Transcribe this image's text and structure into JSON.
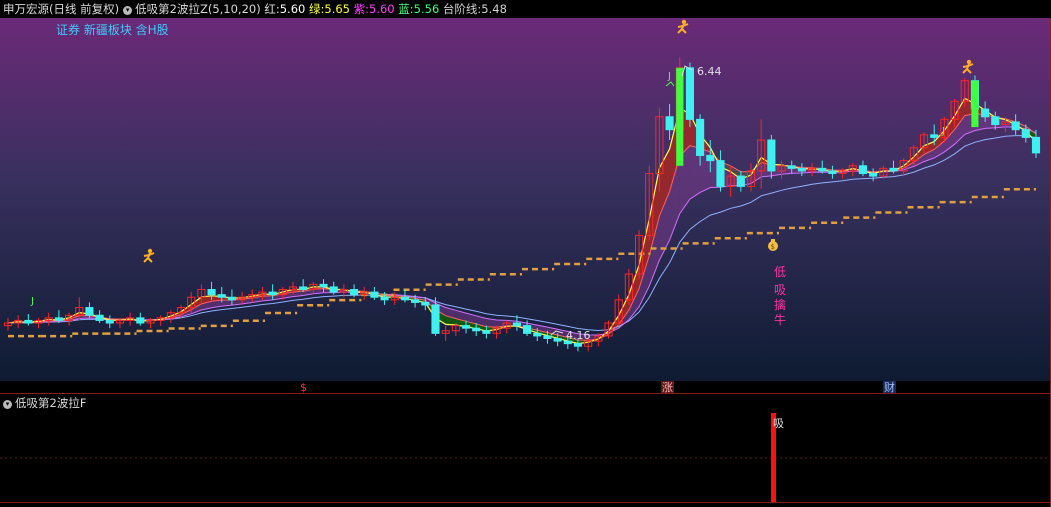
{
  "header": {
    "stock": "申万宏源",
    "mode": "(日线 前复权)",
    "indicator": "低吸第2波拉Z(5,10,20)",
    "items": [
      {
        "label": "红:",
        "value": "5.60",
        "color": "#ff4040"
      },
      {
        "label": "绿:",
        "value": "5.65",
        "color": "#ffff40"
      },
      {
        "label": "紫:",
        "value": "5.60",
        "color": "#ff40ff"
      },
      {
        "label": "蓝:",
        "value": "5.56",
        "color": "#40ff40"
      },
      {
        "label": "台阶线:",
        "value": "5.48",
        "color": "#d0d0d0"
      }
    ]
  },
  "tags": "证券 新疆板块 含H股",
  "markers": {
    "high_label": "6.44",
    "low_label": "4.16",
    "signal_text": [
      "低",
      "吸",
      "擒",
      "牛"
    ],
    "J": "J",
    "axis_marks": [
      "$",
      "涨",
      "财"
    ]
  },
  "subpanel": {
    "title": "低吸第2波拉F",
    "bar_label": "吸"
  },
  "colors": {
    "bg_top": "#6b2a78",
    "bg_mid": "#38305e",
    "bg_bottom": "#0e1b32",
    "up": "#ff2424",
    "down": "#3ff0f0",
    "step_line": "#e0a040",
    "ribbon_red": "#a02828",
    "ribbon_green": "#0e5f0e",
    "ribbon_purple": "#7a3a8c"
  },
  "chart_data": {
    "type": "candlestick",
    "candles": [
      [
        4.36,
        4.42,
        4.32,
        4.38
      ],
      [
        4.38,
        4.44,
        4.34,
        4.4
      ],
      [
        4.4,
        4.45,
        4.36,
        4.38
      ],
      [
        4.38,
        4.42,
        4.34,
        4.4
      ],
      [
        4.4,
        4.46,
        4.36,
        4.42
      ],
      [
        4.42,
        4.48,
        4.38,
        4.4
      ],
      [
        4.4,
        4.46,
        4.36,
        4.44
      ],
      [
        4.44,
        4.58,
        4.4,
        4.5
      ],
      [
        4.5,
        4.54,
        4.42,
        4.44
      ],
      [
        4.44,
        4.48,
        4.38,
        4.4
      ],
      [
        4.4,
        4.44,
        4.34,
        4.38
      ],
      [
        4.38,
        4.42,
        4.34,
        4.4
      ],
      [
        4.4,
        4.46,
        4.36,
        4.42
      ],
      [
        4.42,
        4.46,
        4.36,
        4.38
      ],
      [
        4.38,
        4.42,
        4.34,
        4.4
      ],
      [
        4.4,
        4.44,
        4.36,
        4.42
      ],
      [
        4.42,
        4.48,
        4.38,
        4.46
      ],
      [
        4.46,
        4.52,
        4.42,
        4.5
      ],
      [
        4.5,
        4.62,
        4.46,
        4.58
      ],
      [
        4.58,
        4.68,
        4.52,
        4.64
      ],
      [
        4.64,
        4.7,
        4.56,
        4.6
      ],
      [
        4.6,
        4.66,
        4.54,
        4.58
      ],
      [
        4.58,
        4.64,
        4.52,
        4.56
      ],
      [
        4.56,
        4.62,
        4.52,
        4.58
      ],
      [
        4.58,
        4.64,
        4.54,
        4.6
      ],
      [
        4.6,
        4.66,
        4.56,
        4.62
      ],
      [
        4.62,
        4.68,
        4.56,
        4.6
      ],
      [
        4.6,
        4.66,
        4.56,
        4.64
      ],
      [
        4.64,
        4.7,
        4.6,
        4.66
      ],
      [
        4.66,
        4.72,
        4.62,
        4.64
      ],
      [
        4.64,
        4.7,
        4.6,
        4.68
      ],
      [
        4.68,
        4.72,
        4.62,
        4.66
      ],
      [
        4.66,
        4.7,
        4.6,
        4.62
      ],
      [
        4.62,
        4.68,
        4.58,
        4.64
      ],
      [
        4.64,
        4.68,
        4.58,
        4.6
      ],
      [
        4.6,
        4.66,
        4.56,
        4.62
      ],
      [
        4.62,
        4.66,
        4.56,
        4.58
      ],
      [
        4.58,
        4.62,
        4.52,
        4.56
      ],
      [
        4.56,
        4.62,
        4.52,
        4.58
      ],
      [
        4.58,
        4.64,
        4.54,
        4.56
      ],
      [
        4.56,
        4.6,
        4.5,
        4.54
      ],
      [
        4.54,
        4.58,
        4.48,
        4.52
      ],
      [
        4.52,
        4.58,
        4.28,
        4.3
      ],
      [
        4.3,
        4.36,
        4.24,
        4.32
      ],
      [
        4.32,
        4.38,
        4.28,
        4.36
      ],
      [
        4.36,
        4.4,
        4.3,
        4.34
      ],
      [
        4.34,
        4.38,
        4.28,
        4.32
      ],
      [
        4.32,
        4.36,
        4.26,
        4.3
      ],
      [
        4.3,
        4.36,
        4.26,
        4.34
      ],
      [
        4.34,
        4.4,
        4.3,
        4.38
      ],
      [
        4.38,
        4.44,
        4.32,
        4.36
      ],
      [
        4.36,
        4.4,
        4.28,
        4.3
      ],
      [
        4.3,
        4.34,
        4.24,
        4.28
      ],
      [
        4.28,
        4.32,
        4.22,
        4.26
      ],
      [
        4.26,
        4.3,
        4.2,
        4.24
      ],
      [
        4.24,
        4.28,
        4.18,
        4.22
      ],
      [
        4.22,
        4.26,
        4.16,
        4.2
      ],
      [
        4.2,
        4.26,
        4.16,
        4.24
      ],
      [
        4.24,
        4.3,
        4.2,
        4.28
      ],
      [
        4.28,
        4.4,
        4.26,
        4.38
      ],
      [
        4.38,
        4.6,
        4.36,
        4.56
      ],
      [
        4.56,
        4.8,
        4.52,
        4.76
      ],
      [
        4.76,
        5.1,
        4.72,
        5.06
      ],
      [
        5.06,
        5.6,
        5.02,
        5.54
      ],
      [
        5.54,
        6.05,
        5.4,
        5.98
      ],
      [
        5.98,
        6.08,
        5.8,
        5.88
      ],
      [
        5.88,
        6.44,
        5.8,
        6.36
      ],
      [
        6.36,
        6.4,
        5.9,
        5.96
      ],
      [
        5.96,
        6.0,
        5.6,
        5.68
      ],
      [
        5.68,
        5.8,
        5.55,
        5.64
      ],
      [
        5.64,
        5.72,
        5.4,
        5.44
      ],
      [
        5.44,
        5.6,
        5.36,
        5.52
      ],
      [
        5.52,
        5.56,
        5.4,
        5.44
      ],
      [
        5.44,
        5.62,
        5.4,
        5.56
      ],
      [
        5.56,
        5.96,
        5.42,
        5.8
      ],
      [
        5.8,
        5.84,
        5.5,
        5.56
      ],
      [
        5.56,
        5.64,
        5.5,
        5.6
      ],
      [
        5.6,
        5.64,
        5.54,
        5.58
      ],
      [
        5.58,
        5.62,
        5.52,
        5.56
      ],
      [
        5.56,
        5.62,
        5.52,
        5.58
      ],
      [
        5.58,
        5.64,
        5.54,
        5.56
      ],
      [
        5.56,
        5.6,
        5.5,
        5.54
      ],
      [
        5.54,
        5.58,
        5.5,
        5.56
      ],
      [
        5.56,
        5.62,
        5.52,
        5.6
      ],
      [
        5.6,
        5.64,
        5.52,
        5.54
      ],
      [
        5.54,
        5.58,
        5.48,
        5.52
      ],
      [
        5.52,
        5.6,
        5.5,
        5.58
      ],
      [
        5.58,
        5.64,
        5.54,
        5.56
      ],
      [
        5.56,
        5.66,
        5.52,
        5.64
      ],
      [
        5.64,
        5.76,
        5.6,
        5.74
      ],
      [
        5.74,
        5.86,
        5.7,
        5.84
      ],
      [
        5.84,
        5.92,
        5.76,
        5.82
      ],
      [
        5.82,
        5.98,
        5.78,
        5.96
      ],
      [
        5.96,
        6.12,
        5.9,
        6.1
      ],
      [
        6.1,
        6.28,
        6.06,
        6.26
      ],
      [
        6.26,
        6.3,
        6.0,
        6.04
      ],
      [
        6.04,
        6.1,
        5.94,
        5.98
      ],
      [
        5.98,
        6.02,
        5.88,
        5.92
      ],
      [
        5.92,
        5.98,
        5.86,
        5.94
      ],
      [
        5.94,
        6.0,
        5.84,
        5.88
      ],
      [
        5.88,
        5.92,
        5.78,
        5.82
      ],
      [
        5.82,
        5.88,
        5.66,
        5.7
      ]
    ],
    "step_line": [
      4.34,
      4.34,
      4.36,
      4.36,
      4.38,
      4.4,
      4.42,
      4.46,
      4.52,
      4.58,
      4.62,
      4.66,
      4.7,
      4.74,
      4.78,
      4.82,
      4.86,
      4.9,
      4.94,
      4.98,
      5.02,
      5.06,
      5.1,
      5.14,
      5.18,
      5.22,
      5.26,
      5.3,
      5.34,
      5.38,
      5.42,
      5.48
    ],
    "price_range": [
      4.0,
      6.7
    ],
    "subpanel_bar_index": 76
  }
}
